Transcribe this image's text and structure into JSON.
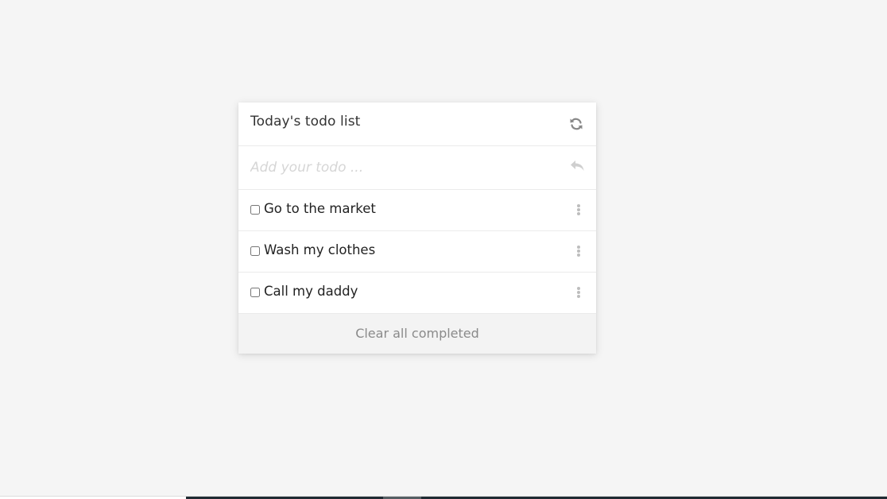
{
  "header": {
    "title": "Today's todo list",
    "refresh_icon": "refresh-icon"
  },
  "input": {
    "placeholder": "Add your todo ...",
    "value": "",
    "enter_icon": "reply-icon"
  },
  "todos": [
    {
      "label": "Go to the market",
      "completed": false
    },
    {
      "label": "Wash my clothes",
      "completed": false
    },
    {
      "label": "Call my daddy",
      "completed": false
    }
  ],
  "footer": {
    "clear_label": "Clear all completed"
  },
  "colors": {
    "background": "#f5f5f5",
    "card": "#ffffff",
    "footer": "#f3f3f3",
    "placeholder": "#d6d6d6",
    "icon": "#888888"
  }
}
